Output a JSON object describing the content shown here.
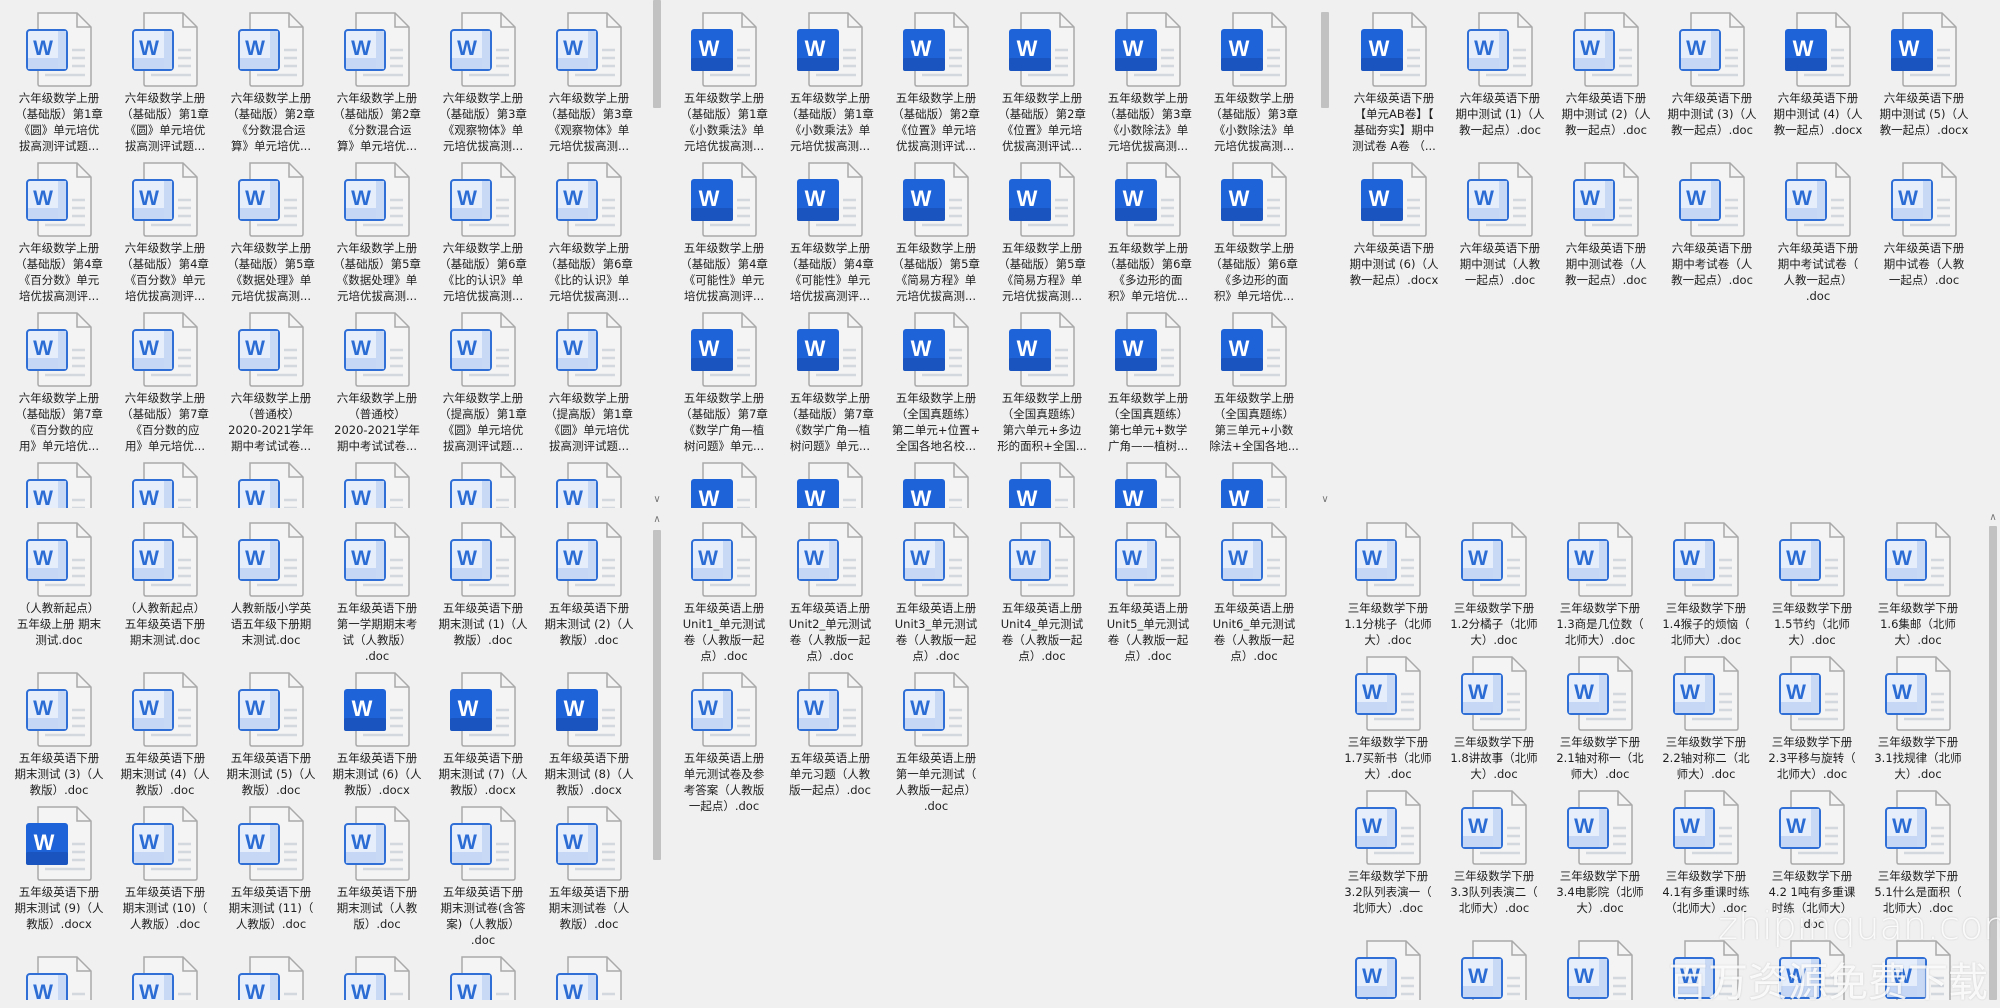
{
  "colors": {
    "background": "#f0f0f0",
    "word_blue": "#1f63d8",
    "word_outline": "#2f6fd6"
  },
  "panels": [
    {
      "id": "top-left",
      "items": [
        {
          "label": "六年级数学上册\n（基础版）第1章\n《圆》单元培优\n拔高测评试题...",
          "style": "outline"
        },
        {
          "label": "六年级数学上册\n（基础版）第1章\n《圆》单元培优\n拔高测评试题...",
          "style": "outline"
        },
        {
          "label": "六年级数学上册\n（基础版）第2章\n《分数混合运\n算》单元培优...",
          "style": "outline"
        },
        {
          "label": "六年级数学上册\n（基础版）第2章\n《分数混合运\n算》单元培优...",
          "style": "outline"
        },
        {
          "label": "六年级数学上册\n（基础版）第3章\n《观察物体》单\n元培优拔高测...",
          "style": "outline"
        },
        {
          "label": "六年级数学上册\n（基础版）第3章\n《观察物体》单\n元培优拔高测...",
          "style": "outline"
        },
        {
          "label": "六年级数学上册\n（基础版）第4章\n《百分数》单元\n培优拔高测评...",
          "style": "outline"
        },
        {
          "label": "六年级数学上册\n（基础版）第4章\n《百分数》单元\n培优拔高测评...",
          "style": "outline"
        },
        {
          "label": "六年级数学上册\n（基础版）第5章\n《数据处理》单\n元培优拔高测...",
          "style": "outline"
        },
        {
          "label": "六年级数学上册\n（基础版）第5章\n《数据处理》单\n元培优拔高测...",
          "style": "outline"
        },
        {
          "label": "六年级数学上册\n（基础版）第6章\n《比的认识》单\n元培优拔高测...",
          "style": "outline"
        },
        {
          "label": "六年级数学上册\n（基础版）第6章\n《比的认识》单\n元培优拔高测...",
          "style": "outline"
        },
        {
          "label": "六年级数学上册\n（基础版）第7章\n《百分数的应\n用》单元培优...",
          "style": "outline"
        },
        {
          "label": "六年级数学上册\n（基础版）第7章\n《百分数的应\n用》单元培优...",
          "style": "outline"
        },
        {
          "label": "六年级数学上册\n（普通校）\n2020-2021学年\n期中考试试卷...",
          "style": "outline"
        },
        {
          "label": "六年级数学上册\n（普通校）\n2020-2021学年\n期中考试试卷...",
          "style": "outline"
        },
        {
          "label": "六年级数学上册\n（提高版）第1章\n《圆》单元培优\n拔高测评试题...",
          "style": "outline"
        },
        {
          "label": "六年级数学上册\n（提高版）第1章\n《圆》单元培优\n拔高测评试题...",
          "style": "outline"
        },
        {
          "style": "outline"
        },
        {
          "style": "outline"
        },
        {
          "style": "outline"
        },
        {
          "style": "outline"
        },
        {
          "style": "outline"
        },
        {
          "style": "outline"
        }
      ]
    },
    {
      "id": "top-middle",
      "items": [
        {
          "label": "五年级数学上册\n（基础版）第1章\n《小数乘法》单\n元培优拔高测...",
          "style": "solid"
        },
        {
          "label": "五年级数学上册\n（基础版）第1章\n《小数乘法》单\n元培优拔高测...",
          "style": "solid"
        },
        {
          "label": "五年级数学上册\n（基础版）第2章\n《位置》单元培\n优拔高测评试...",
          "style": "solid"
        },
        {
          "label": "五年级数学上册\n（基础版）第2章\n《位置》单元培\n优拔高测评试...",
          "style": "solid"
        },
        {
          "label": "五年级数学上册\n（基础版）第3章\n《小数除法》单\n元培优拔高测...",
          "style": "solid"
        },
        {
          "label": "五年级数学上册\n（基础版）第3章\n《小数除法》单\n元培优拔高测...",
          "style": "solid"
        },
        {
          "label": "五年级数学上册\n（基础版）第4章\n《可能性》单元\n培优拔高测评...",
          "style": "solid"
        },
        {
          "label": "五年级数学上册\n（基础版）第4章\n《可能性》单元\n培优拔高测评...",
          "style": "solid"
        },
        {
          "label": "五年级数学上册\n（基础版）第5章\n《简易方程》单\n元培优拔高测...",
          "style": "solid"
        },
        {
          "label": "五年级数学上册\n（基础版）第5章\n《简易方程》单\n元培优拔高测...",
          "style": "solid"
        },
        {
          "label": "五年级数学上册\n（基础版）第6章\n《多边形的面\n积》单元培优...",
          "style": "solid"
        },
        {
          "label": "五年级数学上册\n（基础版）第6章\n《多边形的面\n积》单元培优...",
          "style": "solid"
        },
        {
          "label": "五年级数学上册\n（基础版）第7章\n《数学广角—植\n树问题》单元...",
          "style": "solid"
        },
        {
          "label": "五年级数学上册\n（基础版）第7章\n《数学广角—植\n树问题》单元...",
          "style": "solid"
        },
        {
          "label": "五年级数学上册\n（全国真题练）\n第二单元+位置+\n全国各地名校...",
          "style": "solid"
        },
        {
          "label": "五年级数学上册\n（全国真题练）\n第六单元+多边\n形的面积+全国...",
          "style": "solid"
        },
        {
          "label": "五年级数学上册\n（全国真题练）\n第七单元+数学\n广角——植树...",
          "style": "solid"
        },
        {
          "label": "五年级数学上册\n（全国真题练）\n第三单元+小数\n除法+全国各地...",
          "style": "solid"
        },
        {
          "style": "solid"
        },
        {
          "style": "solid"
        },
        {
          "style": "solid"
        },
        {
          "style": "solid"
        },
        {
          "style": "solid"
        },
        {
          "style": "solid"
        }
      ]
    },
    {
      "id": "top-right",
      "items": [
        {
          "label": "六年级英语下册\n【单元AB卷】【\n基础夯实】期中\n测试卷 A卷 （...",
          "style": "solid"
        },
        {
          "label": "六年级英语下册\n期中测试 (1)（人\n教一起点）.doc",
          "style": "outline"
        },
        {
          "label": "六年级英语下册\n期中测试 (2)（人\n教一起点）.doc",
          "style": "outline"
        },
        {
          "label": "六年级英语下册\n期中测试 (3)（人\n教一起点）.doc",
          "style": "outline"
        },
        {
          "label": "六年级英语下册\n期中测试 (4)（人\n教一起点）.docx",
          "style": "solid"
        },
        {
          "label": "六年级英语下册\n期中测试 (5)（人\n教一起点）.docx",
          "style": "solid"
        },
        {
          "label": "六年级英语下册\n期中测试 (6)（人\n教一起点）.docx",
          "style": "solid"
        },
        {
          "label": "六年级英语下册\n期中测试（人教\n一起点）.doc",
          "style": "outline"
        },
        {
          "label": "六年级英语下册\n期中测试卷（人\n教一起点）.doc",
          "style": "outline"
        },
        {
          "label": "六年级英语下册\n期中考试卷（人\n教一起点）.doc",
          "style": "outline"
        },
        {
          "label": "六年级英语下册\n期中考试试卷（\n人教一起点）\n.doc",
          "style": "outline"
        },
        {
          "label": "六年级英语下册\n期中试卷（人教\n一起点）.doc",
          "style": "outline"
        }
      ]
    },
    {
      "id": "bottom-left",
      "items": [
        {
          "label": "（人教新起点）\n五年级上册 期末\n测试.doc",
          "style": "outline"
        },
        {
          "label": "（人教新起点）\n五年级英语下册\n期末测试.doc",
          "style": "outline"
        },
        {
          "label": "人教新版小学英\n语五年级下册期\n末测试.doc",
          "style": "outline"
        },
        {
          "label": "五年级英语下册\n第一学期期末考\n试（人教版）\n.doc",
          "style": "outline"
        },
        {
          "label": "五年级英语下册\n期末测试 (1)（人\n教版）.doc",
          "style": "outline"
        },
        {
          "label": "五年级英语下册\n期末测试 (2)（人\n教版）.doc",
          "style": "outline"
        },
        {
          "label": "五年级英语下册\n期末测试 (3)（人\n教版）.doc",
          "style": "outline"
        },
        {
          "label": "五年级英语下册\n期末测试 (4)（人\n教版）.doc",
          "style": "outline"
        },
        {
          "label": "五年级英语下册\n期末测试 (5)（人\n教版）.doc",
          "style": "outline"
        },
        {
          "label": "五年级英语下册\n期末测试 (6)（人\n教版）.docx",
          "style": "solid"
        },
        {
          "label": "五年级英语下册\n期末测试 (7)（人\n教版）.docx",
          "style": "solid"
        },
        {
          "label": "五年级英语下册\n期末测试 (8)（人\n教版）.docx",
          "style": "solid"
        },
        {
          "label": "五年级英语下册\n期末测试 (9)（人\n教版）.docx",
          "style": "solid"
        },
        {
          "label": "五年级英语下册\n期末测试 (10)（\n人教版）.doc",
          "style": "outline"
        },
        {
          "label": "五年级英语下册\n期末测试 (11)（\n人教版）.doc",
          "style": "outline"
        },
        {
          "label": "五年级英语下册\n期末测试（人教\n版）.doc",
          "style": "outline"
        },
        {
          "label": "五年级英语下册\n期末测试卷(含答\n案)（人教版）\n.doc",
          "style": "outline"
        },
        {
          "label": "五年级英语下册\n期末测试卷（人\n教版）.doc",
          "style": "outline"
        },
        {
          "style": "outline"
        },
        {
          "style": "outline"
        },
        {
          "style": "outline"
        },
        {
          "style": "outline"
        },
        {
          "style": "outline"
        },
        {
          "style": "outline"
        }
      ]
    },
    {
      "id": "bottom-middle",
      "items": [
        {
          "label": "五年级英语上册\nUnit1_单元测试\n卷（人教版一起\n点）.doc",
          "style": "outline"
        },
        {
          "label": "五年级英语上册\nUnit2_单元测试\n卷（人教版一起\n点）.doc",
          "style": "outline"
        },
        {
          "label": "五年级英语上册\nUnit3_单元测试\n卷（人教版一起\n点）.doc",
          "style": "outline"
        },
        {
          "label": "五年级英语上册\nUnit4_单元测试\n卷（人教版一起\n点）.doc",
          "style": "outline"
        },
        {
          "label": "五年级英语上册\nUnit5_单元测试\n卷（人教版一起\n点）.doc",
          "style": "outline"
        },
        {
          "label": "五年级英语上册\nUnit6_单元测试\n卷（人教版一起\n点）.doc",
          "style": "outline"
        },
        {
          "label": "五年级英语上册\n单元测试卷及参\n考答案（人教版\n一起点）.doc",
          "style": "outline"
        },
        {
          "label": "五年级英语上册\n单元习题（人教\n版一起点）.doc",
          "style": "outline"
        },
        {
          "label": "五年级英语上册\n第一单元测试（\n人教版一起点）\n.doc",
          "style": "outline"
        }
      ]
    },
    {
      "id": "bottom-right",
      "items": [
        {
          "label": "三年级数学下册\n1.1分桃子（北师\n大）.doc",
          "style": "outline"
        },
        {
          "label": "三年级数学下册\n1.2分橘子（北师\n大）.doc",
          "style": "outline"
        },
        {
          "label": "三年级数学下册\n1.3商是几位数（\n北师大）.doc",
          "style": "outline"
        },
        {
          "label": "三年级数学下册\n1.4猴子的烦恼（\n北师大）.doc",
          "style": "outline"
        },
        {
          "label": "三年级数学下册\n1.5节约（北师\n大）.doc",
          "style": "outline"
        },
        {
          "label": "三年级数学下册\n1.6集邮（北师\n大）.doc",
          "style": "outline"
        },
        {
          "label": "三年级数学下册\n1.7买新书（北师\n大）.doc",
          "style": "outline"
        },
        {
          "label": "三年级数学下册\n1.8讲故事（北师\n大）.doc",
          "style": "outline"
        },
        {
          "label": "三年级数学下册\n2.1轴对称一（北\n师大）.doc",
          "style": "outline"
        },
        {
          "label": "三年级数学下册\n2.2轴对称二（北\n师大）.doc",
          "style": "outline"
        },
        {
          "label": "三年级数学下册\n2.3平移与旋转（\n北师大）.doc",
          "style": "outline"
        },
        {
          "label": "三年级数学下册\n3.1找规律（北师\n大）.doc",
          "style": "outline"
        },
        {
          "label": "三年级数学下册\n3.2队列表演一（\n北师大）.doc",
          "style": "outline"
        },
        {
          "label": "三年级数学下册\n3.3队列表演二（\n北师大）.doc",
          "style": "outline"
        },
        {
          "label": "三年级数学下册\n3.4电影院（北师\n大）.doc",
          "style": "outline"
        },
        {
          "label": "三年级数学下册\n4.1有多重课时练\n（北师大）.doc",
          "style": "outline"
        },
        {
          "label": "三年级数学下册\n4.2 1吨有多重课\n时练（北师大）\n.doc",
          "style": "outline"
        },
        {
          "label": "三年级数学下册\n5.1什么是面积（\n北师大）.doc",
          "style": "outline"
        },
        {
          "style": "outline"
        },
        {
          "style": "outline"
        },
        {
          "style": "outline"
        },
        {
          "style": "outline"
        },
        {
          "style": "outline"
        },
        {
          "style": "outline"
        }
      ]
    }
  ],
  "watermark": {
    "line1": "zhipinquan.com",
    "line2": "百万资源免费下载"
  }
}
